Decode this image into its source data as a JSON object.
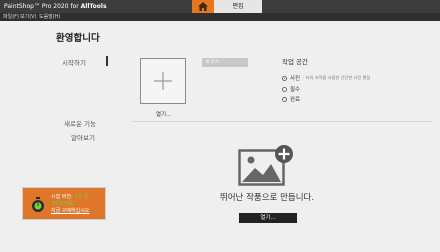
{
  "titlebar": {
    "app_title_prefix": "PaintShop",
    "app_title_suffix": " Pro 2020 for ",
    "app_title_brand": "AllTools",
    "tab_edit": "편집"
  },
  "menubar": {
    "items": [
      "파일(F)",
      "보기(V)",
      "도움말(H)"
    ]
  },
  "welcome": {
    "title": "환영합니다",
    "nav": {
      "get_started": "시작하기",
      "whats_new": "새로운 기능",
      "learn_more": "알아보기"
    }
  },
  "start": {
    "open_label": "열기...",
    "recent_placeholder": "새 문서"
  },
  "workspace": {
    "title": "작업 공간",
    "options": [
      {
        "label": "사진",
        "desc": "· 터치 조작을 사용한 간단한 사진 편집",
        "selected": true
      },
      {
        "label": "필수",
        "desc": "",
        "selected": false
      },
      {
        "label": "완료",
        "desc": "",
        "selected": false
      }
    ]
  },
  "empty_state": {
    "message": "뛰어난 작품으로 만듭니다.",
    "open_button": "열기..."
  },
  "trial": {
    "line1_label": "시험 버전:",
    "line1_value": " 1일 중",
    "line2": "30일(남음)",
    "buy": "지금 구매하십시오"
  },
  "colors": {
    "accent": "#e8761e",
    "trial_green": "#6fd33a"
  }
}
